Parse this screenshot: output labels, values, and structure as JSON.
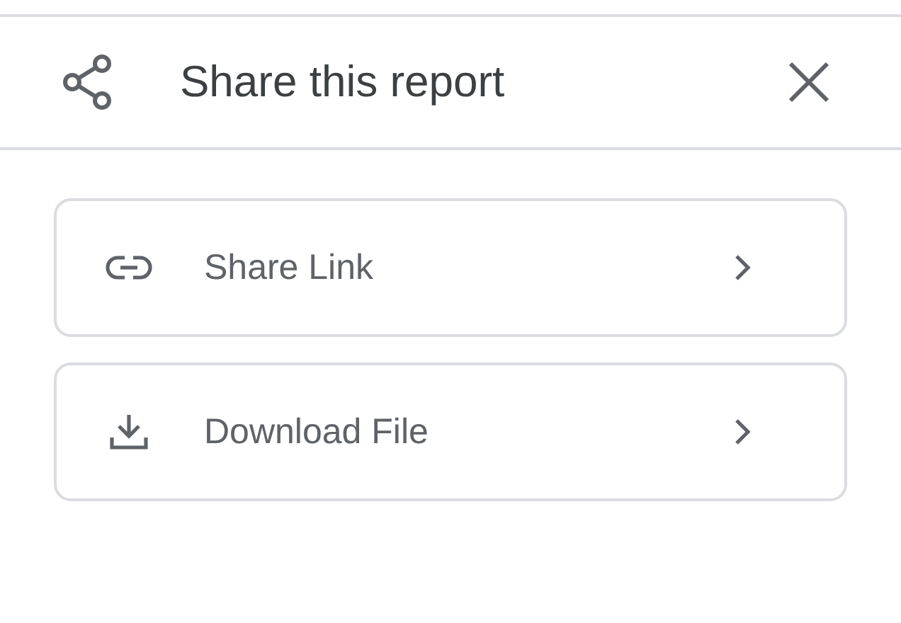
{
  "header": {
    "title": "Share this report"
  },
  "options": [
    {
      "kind": "link",
      "label": "Share Link"
    },
    {
      "kind": "download",
      "label": "Download File"
    }
  ]
}
